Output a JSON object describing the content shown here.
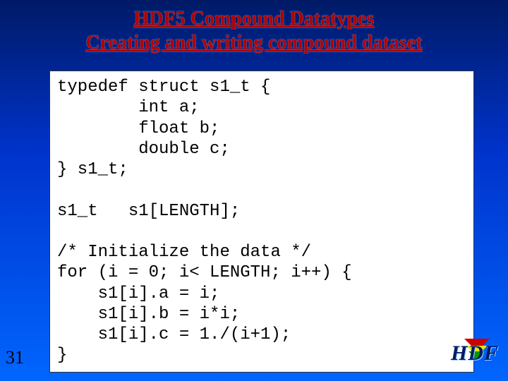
{
  "title": {
    "line1": "HDF5 Compound Datatypes",
    "line2": "Creating and writing compound dataset"
  },
  "code": "typedef struct s1_t {\n        int a;\n        float b;\n        double c;\n} s1_t;\n\ns1_t   s1[LENGTH];\n\n/* Initialize the data */\nfor (i = 0; i< LENGTH; i++) {\n    s1[i].a = i;\n    s1[i].b = i*i;\n    s1[i].c = 1./(i+1);\n}",
  "slide_number": "31",
  "logo_text": "HDF"
}
